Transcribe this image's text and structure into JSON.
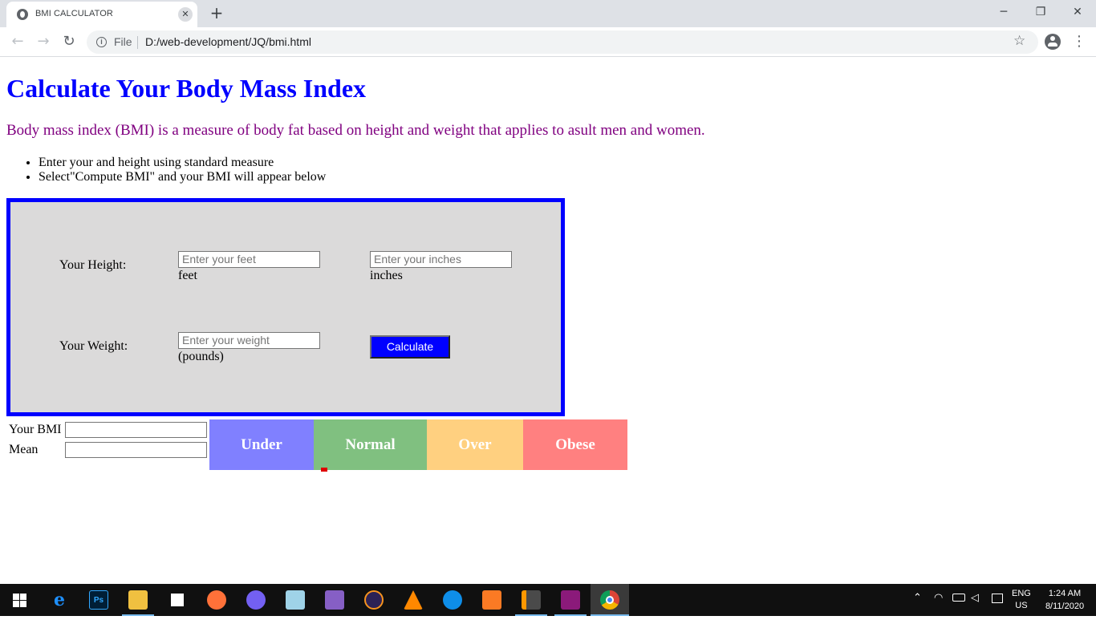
{
  "browser": {
    "tab_title": "BMI CALCULATOR",
    "tab_close_glyph": "✕",
    "new_tab_glyph": "+",
    "window_controls": {
      "minimize": "─",
      "restore": "❐",
      "close": "✕"
    },
    "nav": {
      "back": "←",
      "forward": "→",
      "reload": "↻"
    },
    "omnibox": {
      "info_glyph": "i",
      "scheme_label": "File",
      "url": "D:/web-development/JQ/bmi.html"
    },
    "star_glyph": "☆",
    "menu_glyph": "⋮"
  },
  "page": {
    "title": "Calculate Your Body Mass Index",
    "description": "Body mass index (BMI) is a measure of body fat based on height and weight that applies to asult men and women.",
    "instructions": [
      "Enter your and height using standard measure",
      "Select\"Compute BMI\" and your BMI will appear below"
    ],
    "form": {
      "height_label": "Your Height:",
      "feet_placeholder": "Enter your feet",
      "feet_unit": "feet",
      "inches_placeholder": "Enter your inches",
      "inches_unit": "inches",
      "weight_label": "Your Weight:",
      "weight_placeholder": "Enter your weight",
      "weight_unit": "(pounds)",
      "calculate_label": "Calculate"
    },
    "results": {
      "bmi_label": "Your BMI",
      "mean_label": "Mean",
      "bmi_value": "",
      "mean_value": ""
    },
    "scale": [
      {
        "label": "Under",
        "color": "#8080ff"
      },
      {
        "label": "Normal",
        "color": "#80c080"
      },
      {
        "label": "Over",
        "color": "#ffd080"
      },
      {
        "label": "Obese",
        "color": "#ff8080"
      }
    ]
  },
  "taskbar": {
    "photoshop_label": "Ps",
    "language": {
      "line1": "ENG",
      "line2": "US"
    },
    "clock": {
      "time": "1:24 AM",
      "date": "8/11/2020"
    }
  },
  "colors": {
    "title": "#0000ff",
    "description": "#800080",
    "box_border": "#0000ff",
    "box_background": "#dbdada",
    "button": "#0000ff",
    "marker": "#e00000"
  }
}
